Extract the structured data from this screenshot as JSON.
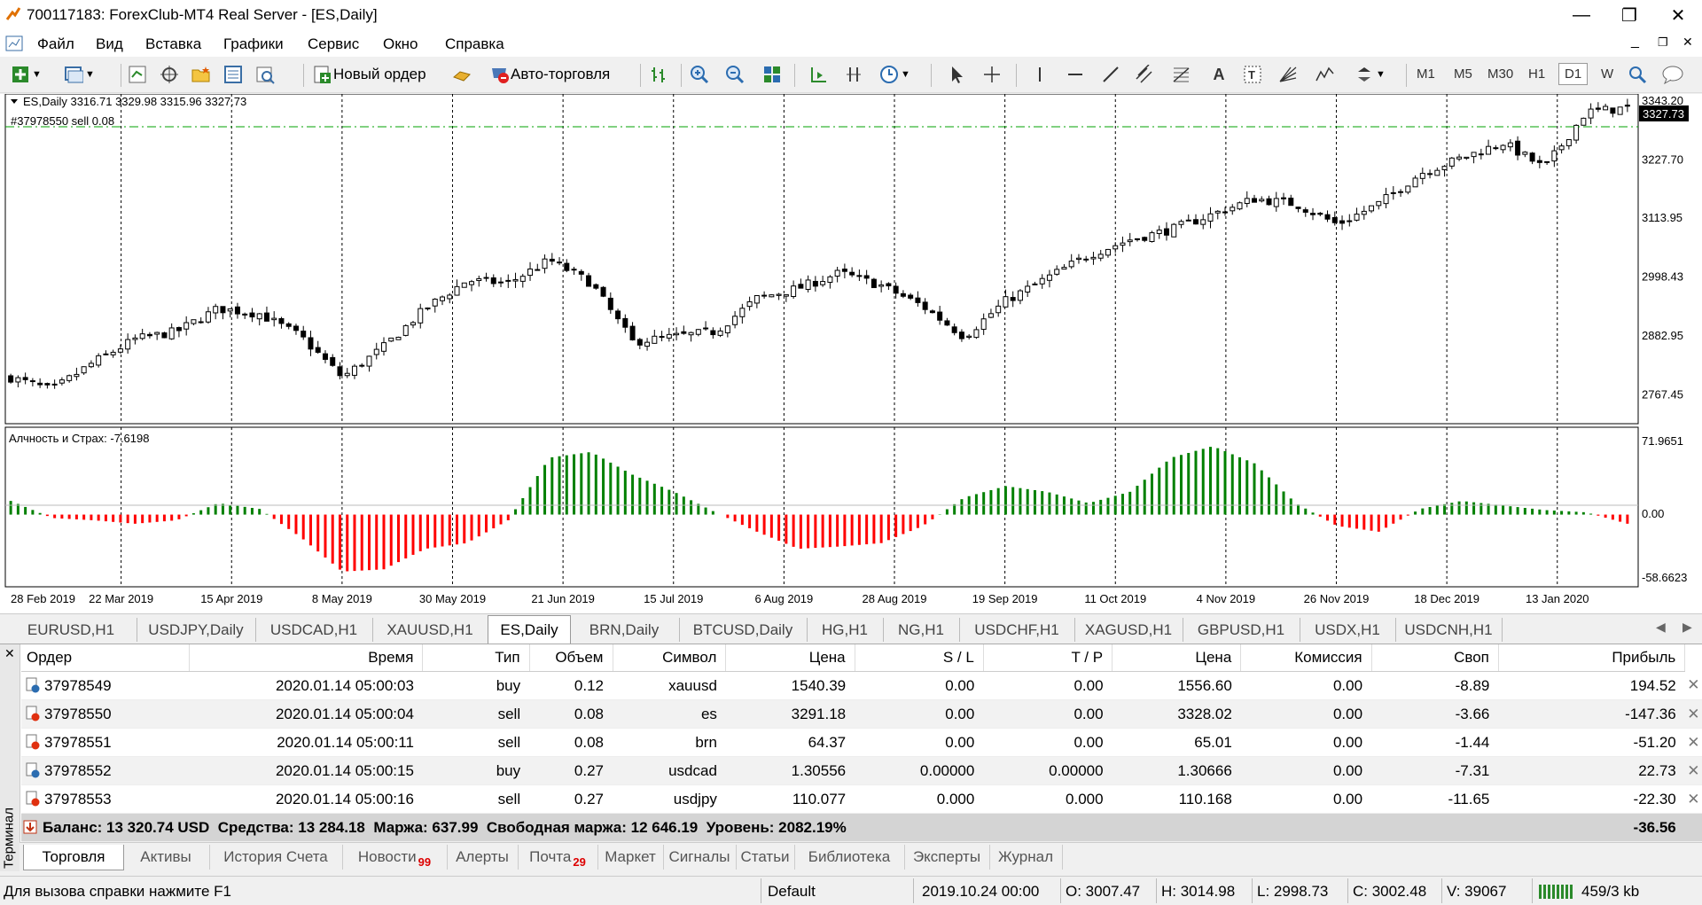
{
  "window": {
    "title": "700117183: ForexClub-MT4 Real Server - [ES,Daily]",
    "controls": {
      "minimize": "—",
      "restore": "❐",
      "close": "✕"
    }
  },
  "menu": [
    "Файл",
    "Вид",
    "Вставка",
    "Графики",
    "Сервис",
    "Окно",
    "Справка"
  ],
  "toolbar": {
    "new_order": "Новый ордер",
    "auto_trading": "Авто-торговля",
    "timeframes": [
      "M1",
      "M5",
      "M30",
      "H1",
      "D1",
      "W"
    ],
    "active_timeframe": "D1"
  },
  "chart": {
    "symbol_info": "ES,Daily  3316.71 3329.98 3315.96 3327.73",
    "order_line_label": "#37978550 sell 0.08",
    "current_price": "3327.73",
    "price_ticks": [
      "3343.20",
      "3227.70",
      "3113.95",
      "2998.43",
      "2882.95",
      "2767.45"
    ],
    "indicator_label": "Алчность и Страх: -7.6198",
    "indicator_ticks": [
      "71.9651",
      "0.00",
      "-58.6623"
    ],
    "dates": [
      "28 Feb 2019",
      "22 Mar 2019",
      "15 Apr 2019",
      "8 May 2019",
      "30 May 2019",
      "21 Jun 2019",
      "15 Jul 2019",
      "6 Aug 2019",
      "28 Aug 2019",
      "19 Sep 2019",
      "11 Oct 2019",
      "4 Nov 2019",
      "26 Nov 2019",
      "18 Dec 2019",
      "13 Jan 2020"
    ],
    "colors": {
      "up": "#008000",
      "down": "#ff0000",
      "order_line": "#00a000",
      "candle": "#000000"
    }
  },
  "chart_data": {
    "type": "candlestick",
    "title": "ES,Daily",
    "ylim": [
      2720,
      3345
    ],
    "close_anchors": [
      2800,
      2775,
      2830,
      2875,
      2890,
      2935,
      2925,
      2880,
      2800,
      2860,
      2935,
      2990,
      2985,
      3030,
      2985,
      2870,
      2880,
      2890,
      2955,
      2975,
      3005,
      2980,
      2940,
      2880,
      2950,
      2995,
      3040,
      3070,
      3090,
      3120,
      3150,
      3140,
      3100,
      3140,
      3200,
      3230,
      3260,
      3210,
      3320,
      3328
    ],
    "indicator": {
      "name": "Алчность и Страх",
      "ylim": [
        -58.6623,
        71.9651
      ],
      "anchors": [
        12,
        -3,
        -5,
        -8,
        -5,
        10,
        5,
        -20,
        -50,
        -48,
        -30,
        -25,
        -5,
        50,
        55,
        35,
        20,
        2,
        -15,
        -30,
        -28,
        -25,
        -10,
        15,
        25,
        20,
        10,
        20,
        50,
        60,
        45,
        10,
        -10,
        -15,
        5,
        12,
        8,
        4,
        2,
        -8
      ]
    }
  },
  "chart_tabs": [
    "EURUSD,H1",
    "USDJPY,Daily",
    "USDCAD,H1",
    "XAUUSD,H1",
    "ES,Daily",
    "BRN,Daily",
    "BTCUSD,Daily",
    "HG,H1",
    "NG,H1",
    "USDCHF,H1",
    "XAGUSD,H1",
    "GBPUSD,H1",
    "USDX,H1",
    "USDCNH,H1"
  ],
  "active_chart_tab": "ES,Daily",
  "terminal": {
    "side_label": "Терминал",
    "columns": [
      "Ордер",
      "Время",
      "Тип",
      "Объем",
      "Символ",
      "Цена",
      "S / L",
      "T / P",
      "Цена",
      "Комиссия",
      "Своп",
      "Прибыль"
    ],
    "rows": [
      [
        "37978549",
        "2020.01.14 05:00:03",
        "buy",
        "0.12",
        "xauusd",
        "1540.39",
        "0.00",
        "0.00",
        "1556.60",
        "0.00",
        "-8.89",
        "194.52"
      ],
      [
        "37978550",
        "2020.01.14 05:00:04",
        "sell",
        "0.08",
        "es",
        "3291.18",
        "0.00",
        "0.00",
        "3328.02",
        "0.00",
        "-3.66",
        "-147.36"
      ],
      [
        "37978551",
        "2020.01.14 05:00:11",
        "sell",
        "0.08",
        "brn",
        "64.37",
        "0.00",
        "0.00",
        "65.01",
        "0.00",
        "-1.44",
        "-51.20"
      ],
      [
        "37978552",
        "2020.01.14 05:00:15",
        "buy",
        "0.27",
        "usdcad",
        "1.30556",
        "0.00000",
        "0.00000",
        "1.30666",
        "0.00",
        "-7.31",
        "22.73"
      ],
      [
        "37978553",
        "2020.01.14 05:00:16",
        "sell",
        "0.27",
        "usdjpy",
        "110.077",
        "0.000",
        "0.000",
        "110.168",
        "0.00",
        "-11.65",
        "-22.30"
      ]
    ],
    "summary": "Баланс: 13 320.74 USD  Средства: 13 284.18  Маржа: 637.99  Свободная маржа: 12 646.19  Уровень: 2082.19%",
    "summary_profit": "-36.56",
    "tabs": [
      {
        "label": "Торговля",
        "badge": ""
      },
      {
        "label": "Активы",
        "badge": ""
      },
      {
        "label": "История Счета",
        "badge": ""
      },
      {
        "label": "Новости",
        "badge": "99"
      },
      {
        "label": "Алерты",
        "badge": ""
      },
      {
        "label": "Почта",
        "badge": "29"
      },
      {
        "label": "Маркет",
        "badge": ""
      },
      {
        "label": "Сигналы",
        "badge": ""
      },
      {
        "label": "Статьи",
        "badge": ""
      },
      {
        "label": "Библиотека",
        "badge": ""
      },
      {
        "label": "Эксперты",
        "badge": ""
      },
      {
        "label": "Журнал",
        "badge": ""
      }
    ],
    "active_tab": "Торговля"
  },
  "status": {
    "help": "Для вызова справки нажмите F1",
    "profile": "Default",
    "datetime": "2019.10.24 00:00",
    "open": "O: 3007.47",
    "high": "H: 3014.98",
    "low": "L: 2998.73",
    "close": "C: 3002.48",
    "volume": "V: 39067",
    "traffic": "459/3 kb"
  }
}
